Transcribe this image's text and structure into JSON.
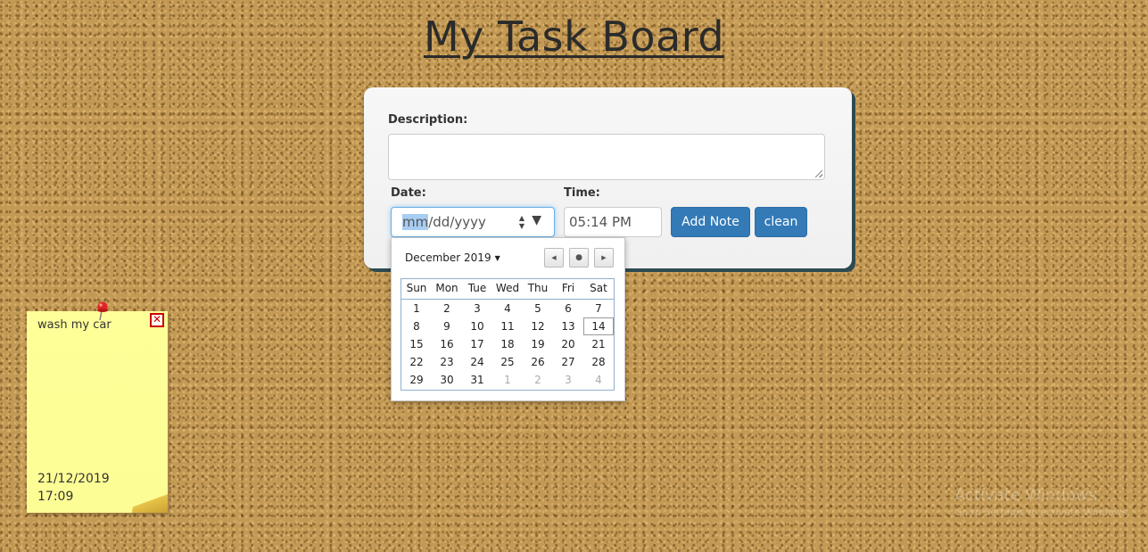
{
  "app": {
    "title": "My Task Board"
  },
  "form": {
    "description_label": "Description:",
    "description_value": "",
    "date_label": "Date:",
    "date_placeholder": {
      "month": "mm",
      "rest": "/dd/yyyy"
    },
    "time_label": "Time:",
    "time_value": "05:14 PM",
    "add_button": "Add Note",
    "clean_button": "clean"
  },
  "calendar": {
    "month_label": "December 2019",
    "weekdays": [
      "Sun",
      "Mon",
      "Tue",
      "Wed",
      "Thu",
      "Fri",
      "Sat"
    ],
    "weeks": [
      [
        "1",
        "2",
        "3",
        "4",
        "5",
        "6",
        "7"
      ],
      [
        "8",
        "9",
        "10",
        "11",
        "12",
        "13",
        "14"
      ],
      [
        "15",
        "16",
        "17",
        "18",
        "19",
        "20",
        "21"
      ],
      [
        "22",
        "23",
        "24",
        "25",
        "26",
        "27",
        "28"
      ],
      [
        "29",
        "30",
        "31",
        "1",
        "2",
        "3",
        "4"
      ]
    ],
    "today": "14"
  },
  "notes": [
    {
      "task": "wash my car",
      "date": "21/12/2019",
      "time": "17:09"
    }
  ],
  "watermark": {
    "title": "Activate Windows",
    "subtitle": "Go to Settings to activate Windows."
  },
  "colors": {
    "primary_button": "#337ab7",
    "note_yellow": "#ffff99",
    "panel_shadow": "#2e4a52",
    "close_red": "#cc0000"
  }
}
